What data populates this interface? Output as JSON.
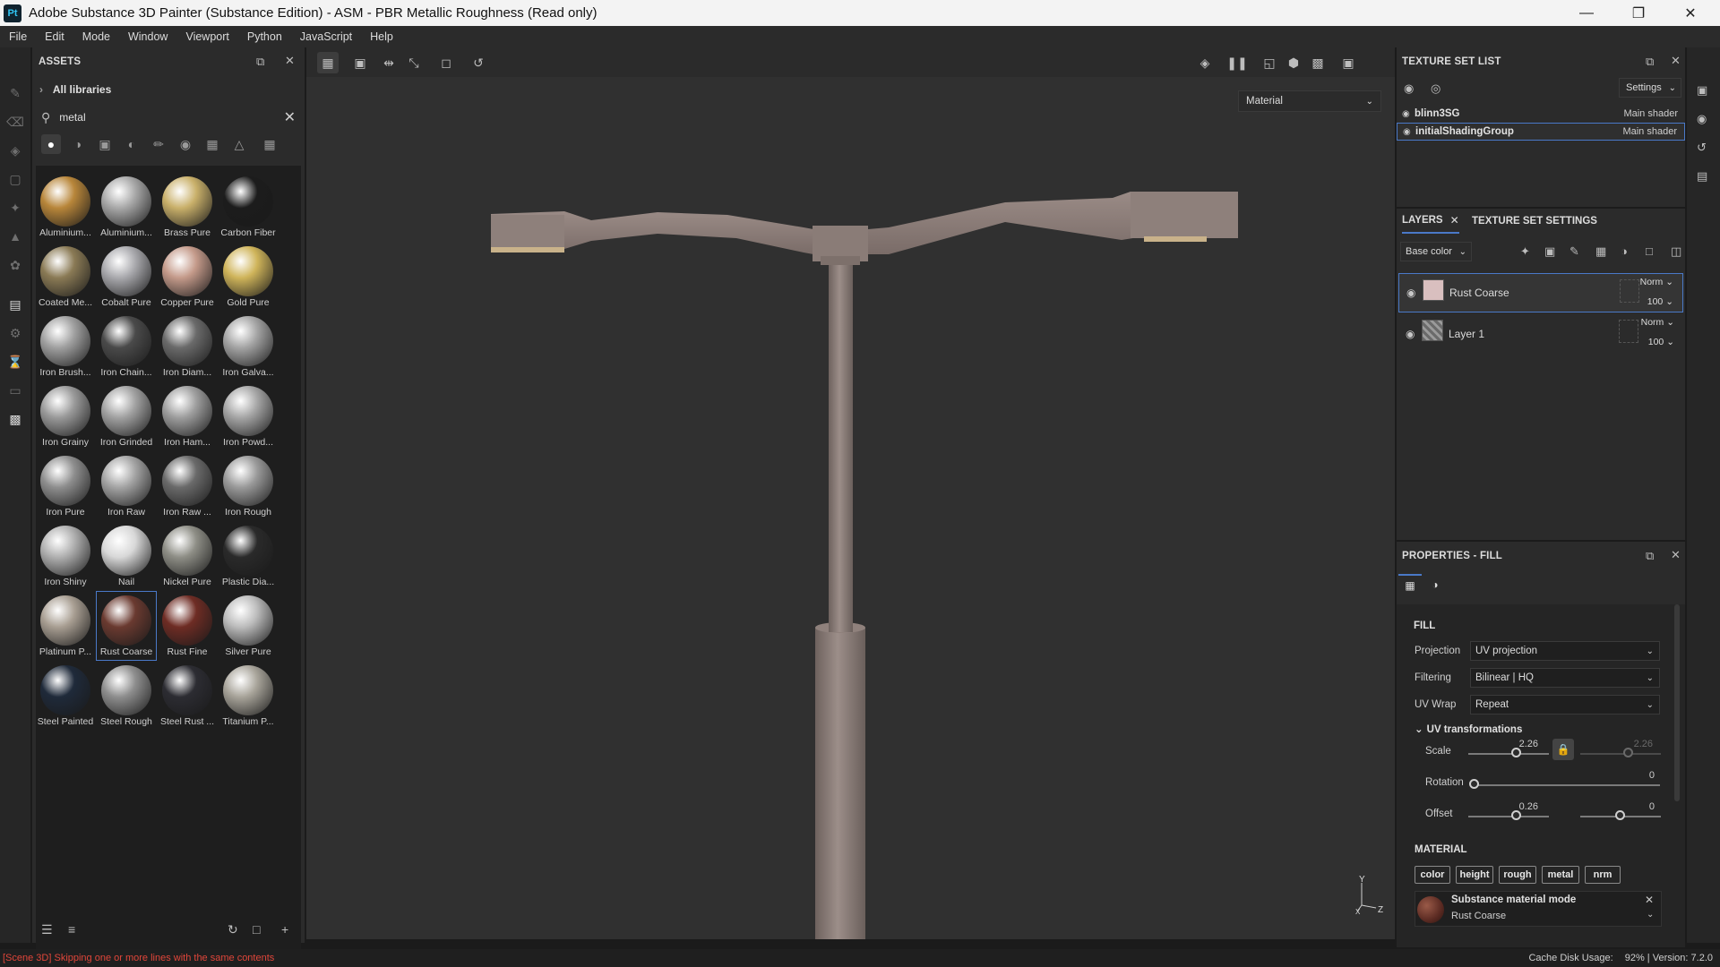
{
  "window": {
    "logo": "Pt",
    "title": "Adobe Substance 3D Painter (Substance Edition) - ASM - PBR Metallic Roughness (Read only)"
  },
  "menu": [
    "File",
    "Edit",
    "Mode",
    "Window",
    "Viewport",
    "Python",
    "JavaScript",
    "Help"
  ],
  "assets": {
    "title": "ASSETS",
    "library": "All libraries",
    "search_value": "metal",
    "items": [
      {
        "label": "Aluminium...",
        "color": "#b8863a"
      },
      {
        "label": "Aluminium...",
        "color": "#a8a8a8"
      },
      {
        "label": "Brass Pure",
        "color": "#c9b06a"
      },
      {
        "label": "Carbon Fiber",
        "color": "#1c1c1c"
      },
      {
        "label": "Coated Me...",
        "color": "#8a7a55"
      },
      {
        "label": "Cobalt Pure",
        "color": "#a9a9ad"
      },
      {
        "label": "Copper Pure",
        "color": "#c49a8a"
      },
      {
        "label": "Gold Pure",
        "color": "#cfb45a"
      },
      {
        "label": "Iron Brush...",
        "color": "#a0a0a0"
      },
      {
        "label": "Iron Chain...",
        "color": "#4a4a4a"
      },
      {
        "label": "Iron Diam...",
        "color": "#6a6a6a"
      },
      {
        "label": "Iron Galva...",
        "color": "#a4a4a4"
      },
      {
        "label": "Iron Grainy",
        "color": "#9a9a9a"
      },
      {
        "label": "Iron Grinded",
        "color": "#a2a2a2"
      },
      {
        "label": "Iron Ham...",
        "color": "#9e9e9e"
      },
      {
        "label": "Iron Powd...",
        "color": "#a6a6a6"
      },
      {
        "label": "Iron Pure",
        "color": "#8e8e8e"
      },
      {
        "label": "Iron Raw",
        "color": "#a4a4a4"
      },
      {
        "label": "Iron Raw ...",
        "color": "#6a6a6a"
      },
      {
        "label": "Iron Rough",
        "color": "#9a9a9a"
      },
      {
        "label": "Iron Shiny",
        "color": "#b0b0b0"
      },
      {
        "label": "Nail",
        "color": "#d8d8d8"
      },
      {
        "label": "Nickel Pure",
        "color": "#8e8e86"
      },
      {
        "label": "Plastic Dia...",
        "color": "#2a2a2a"
      },
      {
        "label": "Platinum P...",
        "color": "#a89e92"
      },
      {
        "label": "Rust Coarse",
        "color": "#6a3a30"
      },
      {
        "label": "Rust Fine",
        "color": "#6e2c24"
      },
      {
        "label": "Silver Pure",
        "color": "#bcbcbc"
      },
      {
        "label": "Steel Painted",
        "color": "#1f2a3a"
      },
      {
        "label": "Steel Rough",
        "color": "#8e8e8e"
      },
      {
        "label": "Steel Rust ...",
        "color": "#2c2c32"
      },
      {
        "label": "Titanium P...",
        "color": "#a8a49a"
      }
    ],
    "selected_index": 25
  },
  "viewport": {
    "material_mode": "Material",
    "axis_x": "X",
    "axis_y": "Y",
    "axis_z": "Z"
  },
  "texture_set_list": {
    "title": "TEXTURE SET LIST",
    "settings_label": "Settings",
    "rows": [
      {
        "name": "blinn3SG",
        "shader": "Main shader"
      },
      {
        "name": "initialShadingGroup",
        "shader": "Main shader"
      }
    ]
  },
  "layers": {
    "tab_layers": "LAYERS",
    "tab_tss": "TEXTURE SET SETTINGS",
    "channel": "Base color",
    "rows": [
      {
        "name": "Rust Coarse",
        "blend": "Norm",
        "opacity": "100"
      },
      {
        "name": "Layer 1",
        "blend": "Norm",
        "opacity": "100"
      }
    ]
  },
  "properties": {
    "title": "PROPERTIES - FILL",
    "section_fill": "FILL",
    "projection_label": "Projection",
    "projection_value": "UV projection",
    "filtering_label": "Filtering",
    "filtering_value": "Bilinear | HQ",
    "uvwrap_label": "UV Wrap",
    "uvwrap_value": "Repeat",
    "uv_section": "UV transformations",
    "scale_label": "Scale",
    "scale_value": "2.26",
    "scale_value_2": "2.26",
    "rotation_label": "Rotation",
    "rotation_value": "0",
    "offset_label": "Offset",
    "offset_value_1": "0.26",
    "offset_value_2": "0",
    "material_section": "MATERIAL",
    "channels": [
      "color",
      "height",
      "rough",
      "metal",
      "nrm"
    ],
    "substance_mode": "Substance material mode",
    "substance_name": "Rust Coarse"
  },
  "status": {
    "message": "[Scene 3D] Skipping one or more lines with the same contents",
    "cache_label": "Cache Disk Usage:",
    "cache_value": "92%",
    "version_sep": "|",
    "version": "Version: 7.2.0"
  },
  "colors": {
    "accent": "#4a79c8",
    "error": "#e0463a",
    "pole": "#8c7d78"
  }
}
